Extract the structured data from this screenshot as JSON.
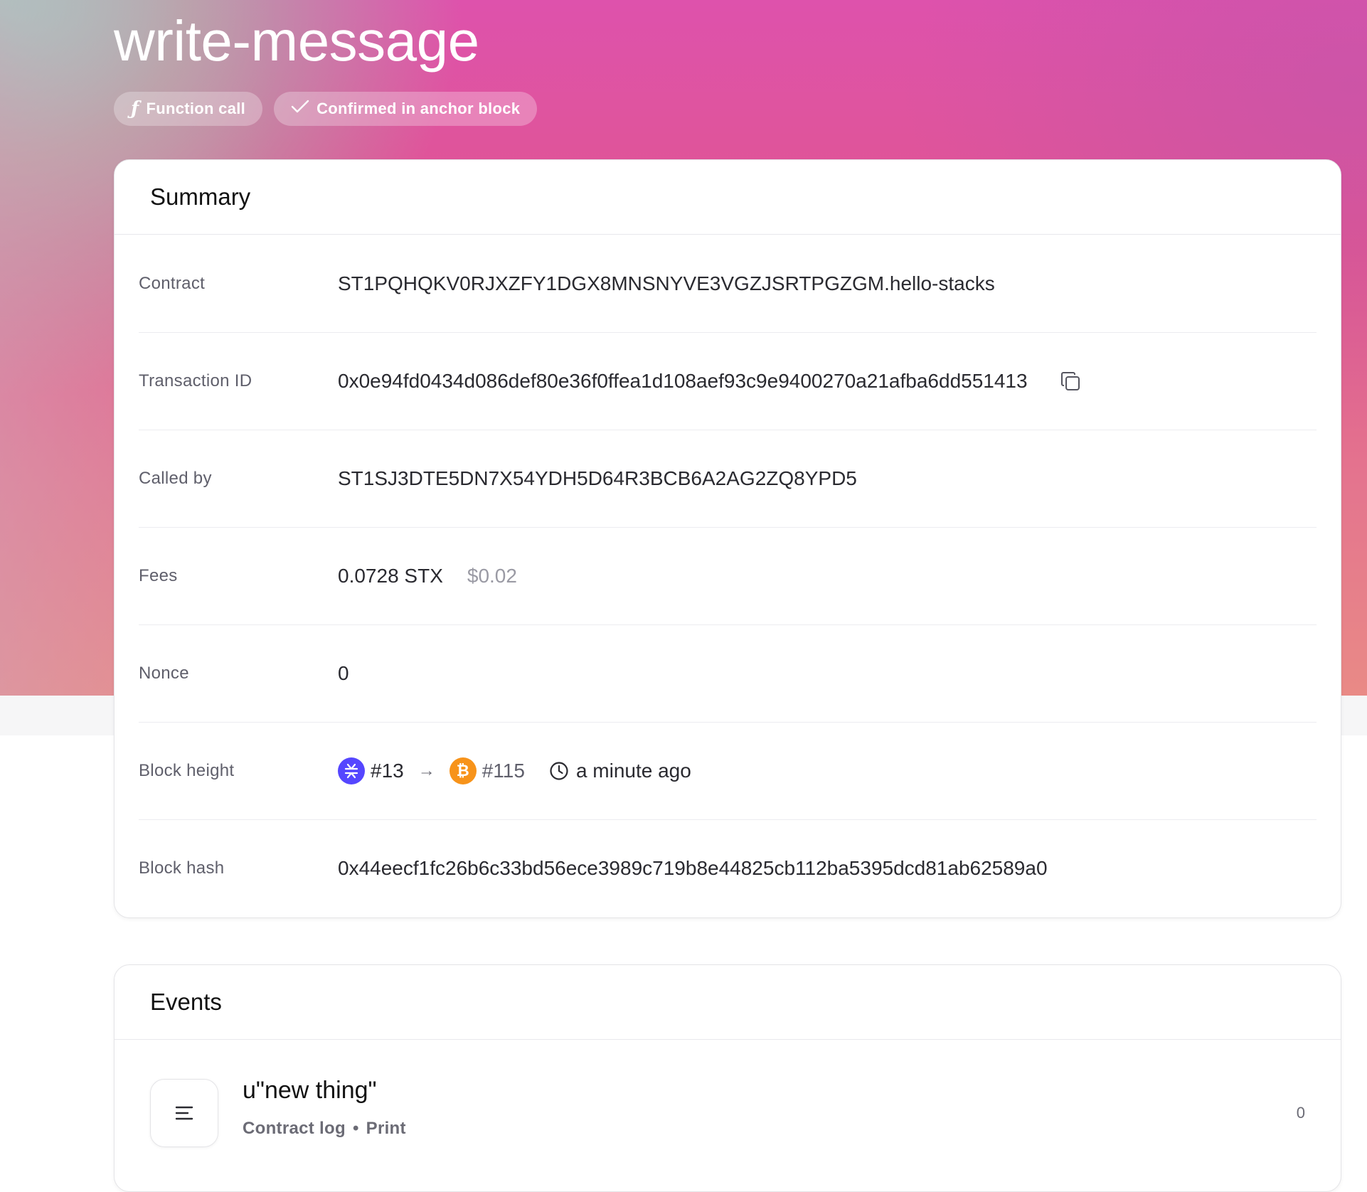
{
  "header": {
    "title": "write-message",
    "badges": {
      "type_icon": "ƒ",
      "type_label": "Function call",
      "status_icon": "checkmark-icon",
      "status_label": "Confirmed in anchor block"
    }
  },
  "summary": {
    "title": "Summary",
    "rows": {
      "contract": {
        "label": "Contract",
        "value": "ST1PQHQKV0RJXZFY1DGX8MNSNYVE3VGZJSRTPGZGM.hello-stacks"
      },
      "tx_id": {
        "label": "Transaction ID",
        "value": "0x0e94fd0434d086def80e36f0ffea1d108aef93c9e9400270a21afba6dd551413",
        "copy_icon": "copy-icon"
      },
      "called_by": {
        "label": "Called by",
        "value": "ST1SJ3DTE5DN7X54YDH5D64R3BCB6A2AG2ZQ8YPD5"
      },
      "fees": {
        "label": "Fees",
        "value": "0.0728 STX",
        "usd": "$0.02"
      },
      "nonce": {
        "label": "Nonce",
        "value": "0"
      },
      "block_height": {
        "label": "Block height",
        "stacks_block": "#13",
        "arrow": "→",
        "bitcoin_block": "#115",
        "time": "a minute ago"
      },
      "block_hash": {
        "label": "Block hash",
        "value": "0x44eecf1fc26b6c33bd56ece3989c719b8e44825cb112ba5395dcd81ab62589a0"
      }
    }
  },
  "events": {
    "title": "Events",
    "items": [
      {
        "title": "u\"new thing\"",
        "type": "Contract log",
        "separator": "•",
        "subtype": "Print",
        "index": "0",
        "icon": "list-lines-icon"
      }
    ]
  },
  "colors": {
    "stacks_brand": "#5546ff",
    "bitcoin_brand": "#f7931a",
    "hero_pink": "#e05690",
    "hero_mint": "#8ce2cc"
  }
}
